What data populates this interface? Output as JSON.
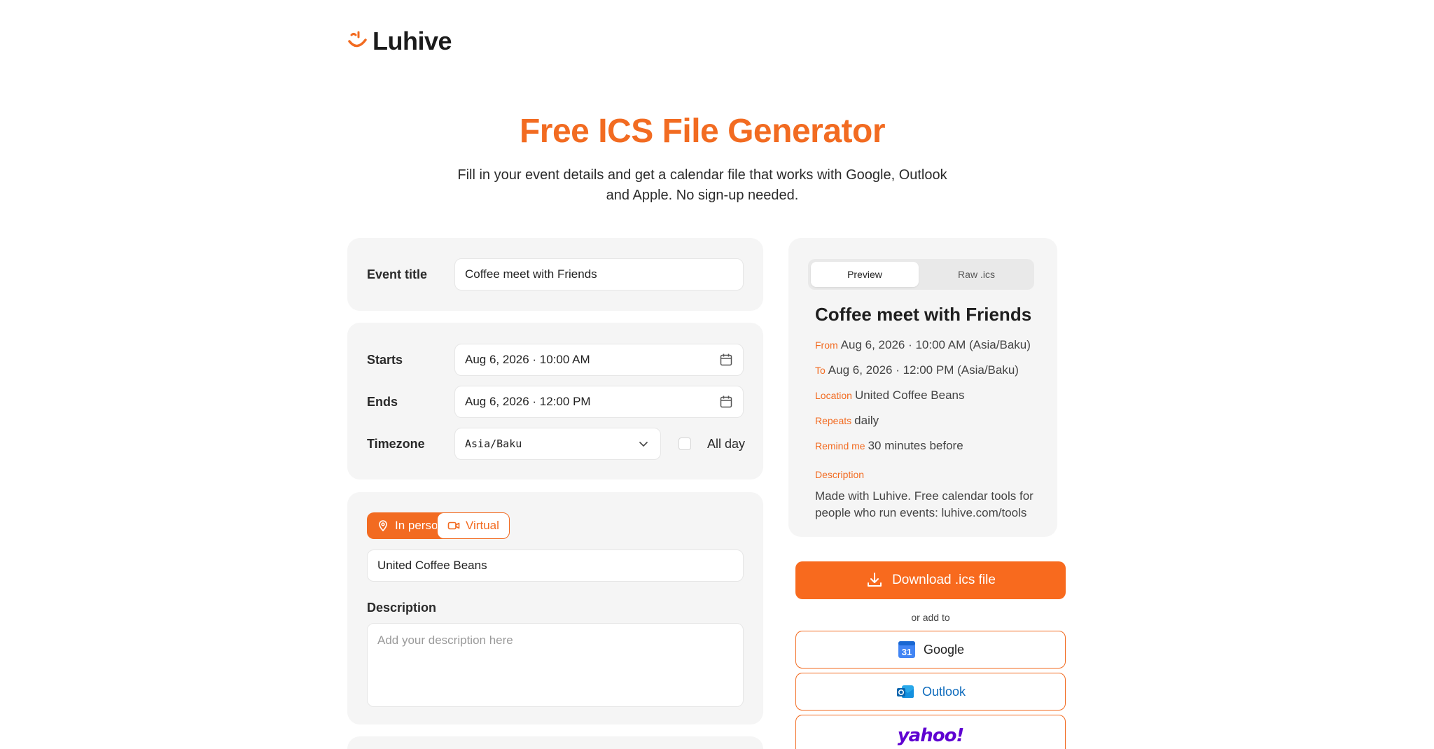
{
  "brand": {
    "name": "Luhive",
    "accent": "#f26b21"
  },
  "hero": {
    "title": "Free ICS File Generator",
    "subtitle": "Fill in your event details and get a calendar file that works with Google, Outlook and Apple. No sign-up needed."
  },
  "form": {
    "event_title_label": "Event title",
    "event_title_value": "Coffee meet with Friends",
    "starts_label": "Starts",
    "starts_value": "Aug 6, 2026 · 10:00 AM",
    "ends_label": "Ends",
    "ends_value": "Aug 6, 2026 · 12:00 PM",
    "timezone_label": "Timezone",
    "timezone_value": "Asia/Baku",
    "allday_label": "All day",
    "allday_checked": false,
    "mode_in_person": "In person",
    "mode_virtual": "Virtual",
    "location_value": "United Coffee Beans",
    "description_label": "Description",
    "description_placeholder": "Add your description here"
  },
  "preview": {
    "tab_preview": "Preview",
    "tab_raw": "Raw .ics",
    "title": "Coffee meet with Friends",
    "from_key": "From",
    "from_value": "Aug 6, 2026 · 10:00 AM (Asia/Baku)",
    "to_key": "To",
    "to_value": "Aug 6, 2026 · 12:00 PM (Asia/Baku)",
    "location_key": "Location",
    "location_value": "United Coffee Beans",
    "repeats_key": "Repeats",
    "repeats_value": "daily",
    "remind_key": "Remind me",
    "remind_value": "30 minutes before",
    "description_key": "Description",
    "description_value": "Made with Luhive. Free calendar tools for people who run events: luhive.com/tools"
  },
  "actions": {
    "download_label": "Download .ics file",
    "or_add_label": "or add to",
    "google_label": "Google",
    "google_icon_number": "31",
    "outlook_label": "Outlook",
    "yahoo_label": "yahoo!"
  }
}
